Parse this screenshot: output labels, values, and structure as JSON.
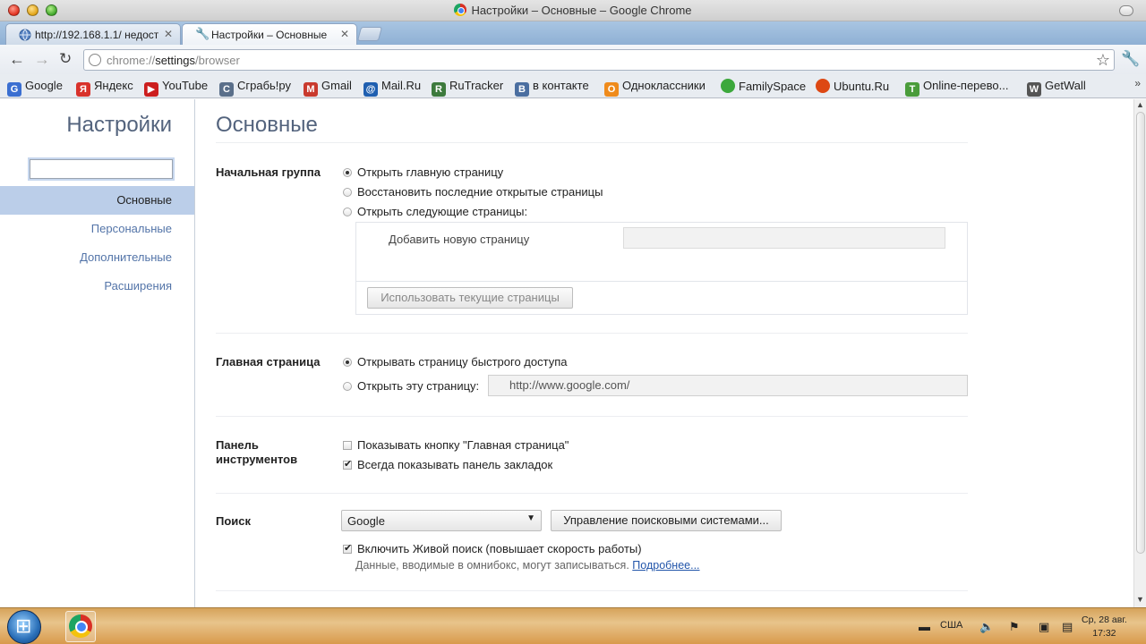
{
  "window": {
    "title": "Настройки – Основные – Google Chrome"
  },
  "tabs": [
    {
      "label": "http://192.168.1.1/ недост",
      "active": false
    },
    {
      "label": "Настройки – Основные",
      "active": true
    }
  ],
  "omnibox": {
    "scheme": "chrome://",
    "host": "settings",
    "path": "/browser"
  },
  "bookmarks": [
    {
      "label": "Google",
      "icon": "G",
      "color": "#3b6fd1"
    },
    {
      "label": "Яндекс",
      "icon": "Я",
      "color": "#d8322b"
    },
    {
      "label": "YouTube",
      "icon": "▶",
      "color": "#cc1e1e"
    },
    {
      "label": "Сграбь!ру",
      "icon": "С",
      "color": "#5a6f8a"
    },
    {
      "label": "Gmail",
      "icon": "M",
      "color": "#c93a2e"
    },
    {
      "label": "Mail.Ru",
      "icon": "@",
      "color": "#1f5fb0"
    },
    {
      "label": "RuTracker",
      "icon": "R",
      "color": "#3d7a3d"
    },
    {
      "label": "в контакте",
      "icon": "B",
      "color": "#4a6ea0"
    },
    {
      "label": "Одноклассники",
      "icon": "О",
      "color": "#ef8b1c"
    },
    {
      "label": "FamilySpace",
      "icon": "●",
      "color": "#3ca83c"
    },
    {
      "label": "Ubuntu.Ru",
      "icon": "◉",
      "color": "#dd4814"
    },
    {
      "label": "Online-перево...",
      "icon": "T",
      "color": "#4a9c3b"
    },
    {
      "label": "GetWall",
      "icon": "W",
      "color": "#555555"
    }
  ],
  "sidebar": {
    "title": "Настройки",
    "search_value": "",
    "items": [
      {
        "label": "Основные",
        "selected": true
      },
      {
        "label": "Персональные",
        "selected": false
      },
      {
        "label": "Дополнительные",
        "selected": false
      },
      {
        "label": "Расширения",
        "selected": false
      }
    ]
  },
  "main": {
    "title": "Основные",
    "startup": {
      "label": "Начальная группа",
      "options": [
        {
          "label": "Открыть главную страницу",
          "selected": true
        },
        {
          "label": "Восстановить последние открытые страницы",
          "selected": false
        },
        {
          "label": "Открыть следующие страницы:",
          "selected": false
        }
      ],
      "add_page_label": "Добавить новую страницу",
      "add_page_value": "",
      "use_current_button": "Использовать текущие страницы"
    },
    "homepage": {
      "label": "Главная страница",
      "options": [
        {
          "label": "Открывать страницу быстрого доступа",
          "selected": true
        },
        {
          "label": "Открыть эту страницу:",
          "selected": false
        }
      ],
      "url": "http://www.google.com/"
    },
    "toolbar": {
      "label_line1": "Панель",
      "label_line2": "инструментов",
      "options": [
        {
          "label": "Показывать кнопку \"Главная страница\"",
          "checked": false
        },
        {
          "label": "Всегда показывать панель закладок",
          "checked": true
        }
      ]
    },
    "search": {
      "label": "Поиск",
      "engine": "Google",
      "manage_button": "Управление поисковыми системами...",
      "instant_label": "Включить Живой поиск (повышает скорость работы)",
      "instant_checked": true,
      "note": "Данные, вводимые в омнибокс, могут записываться.",
      "learn_more": "Подробнее..."
    }
  },
  "taskbar": {
    "language": "США",
    "date": "Ср, 28 авг.",
    "time": "17:32"
  }
}
